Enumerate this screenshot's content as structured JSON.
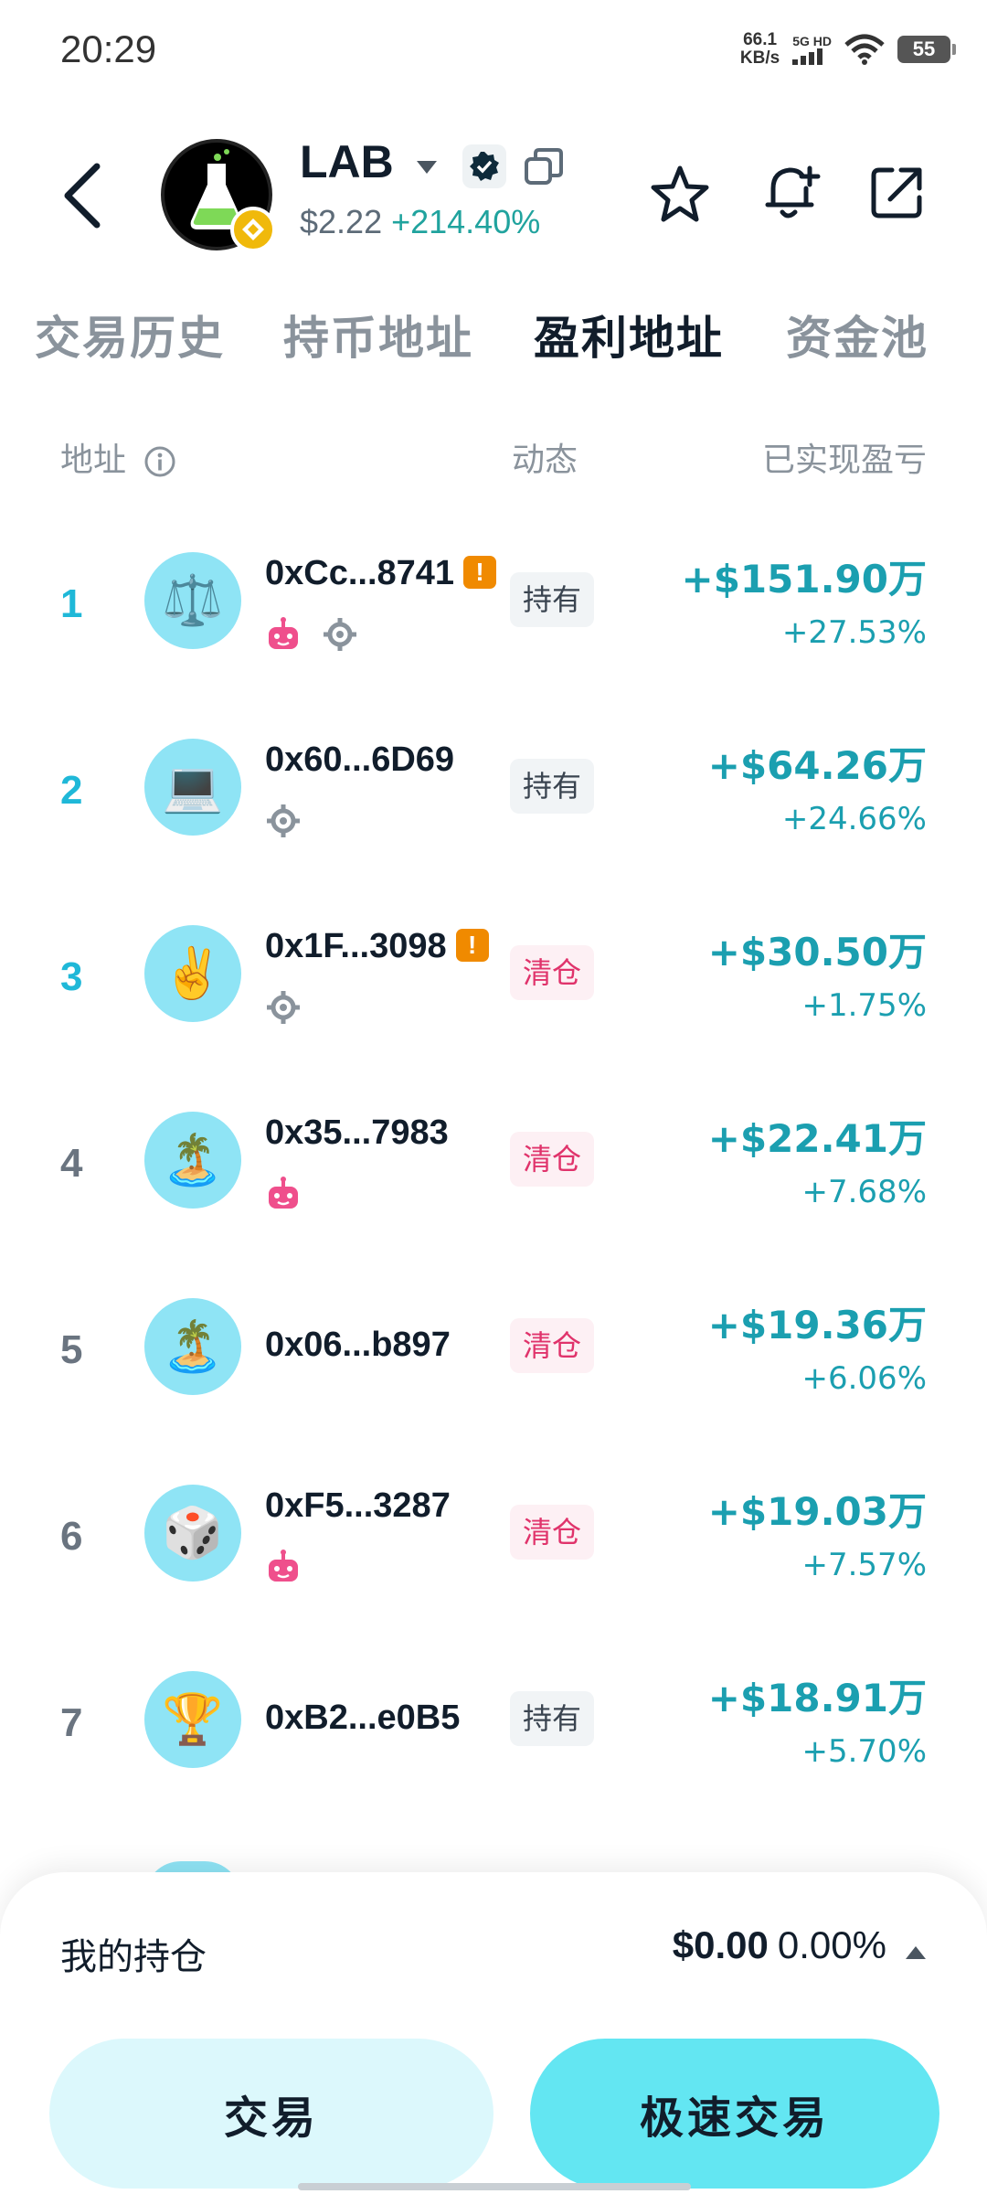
{
  "status_bar": {
    "time": "20:29",
    "net_speed": "66.1",
    "net_unit": "KB/s",
    "signal_label": "5G HD",
    "battery": "55"
  },
  "token": {
    "name": "LAB",
    "price": "$2.22",
    "change": "+214.40%"
  },
  "tabs": [
    {
      "label": "交易历史",
      "active": false
    },
    {
      "label": "持币地址",
      "active": false
    },
    {
      "label": "盈利地址",
      "active": true
    },
    {
      "label": "资金池",
      "active": false
    }
  ],
  "columns": {
    "address": "地址",
    "activity": "动态",
    "realized_pnl": "已实现盈亏"
  },
  "rows": [
    {
      "rank": "1",
      "avatar": "⚖️",
      "address": "0xCc...8741",
      "warning": true,
      "bot": true,
      "target": true,
      "status": "持有",
      "pnl": "+$151.90万",
      "pct": "+27.53%"
    },
    {
      "rank": "2",
      "avatar": "💻",
      "address": "0x60...6D69",
      "warning": false,
      "bot": false,
      "target": true,
      "status": "持有",
      "pnl": "+$64.26万",
      "pct": "+24.66%"
    },
    {
      "rank": "3",
      "avatar": "✌️",
      "address": "0x1F...3098",
      "warning": true,
      "bot": false,
      "target": true,
      "status": "清仓",
      "pnl": "+$30.50万",
      "pct": "+1.75%"
    },
    {
      "rank": "4",
      "avatar": "🏝️",
      "address": "0x35...7983",
      "warning": false,
      "bot": true,
      "target": false,
      "status": "清仓",
      "pnl": "+$22.41万",
      "pct": "+7.68%"
    },
    {
      "rank": "5",
      "avatar": "🏝️",
      "address": "0x06...b897",
      "warning": false,
      "bot": false,
      "target": false,
      "status": "清仓",
      "pnl": "+$19.36万",
      "pct": "+6.06%"
    },
    {
      "rank": "6",
      "avatar": "🎲",
      "address": "0xF5...3287",
      "warning": false,
      "bot": true,
      "target": false,
      "status": "清仓",
      "pnl": "+$19.03万",
      "pct": "+7.57%"
    },
    {
      "rank": "7",
      "avatar": "🏆",
      "address": "0xB2...e0B5",
      "warning": false,
      "bot": false,
      "target": false,
      "status": "持有",
      "pnl": "+$18.91万",
      "pct": "+5.70%"
    }
  ],
  "bottom": {
    "holding_label": "我的持仓",
    "holding_amount": "$0.00",
    "holding_pct": "0.00%",
    "trade_label": "交易",
    "fast_trade_label": "极速交易"
  },
  "colors": {
    "accent": "#1b9fb0",
    "rank_top": "#1fb8d8",
    "hold_tag": "#3a4450",
    "clear_tag": "#e0336b",
    "fast_button": "#63e6f2",
    "trade_button": "#dcf8fc"
  }
}
